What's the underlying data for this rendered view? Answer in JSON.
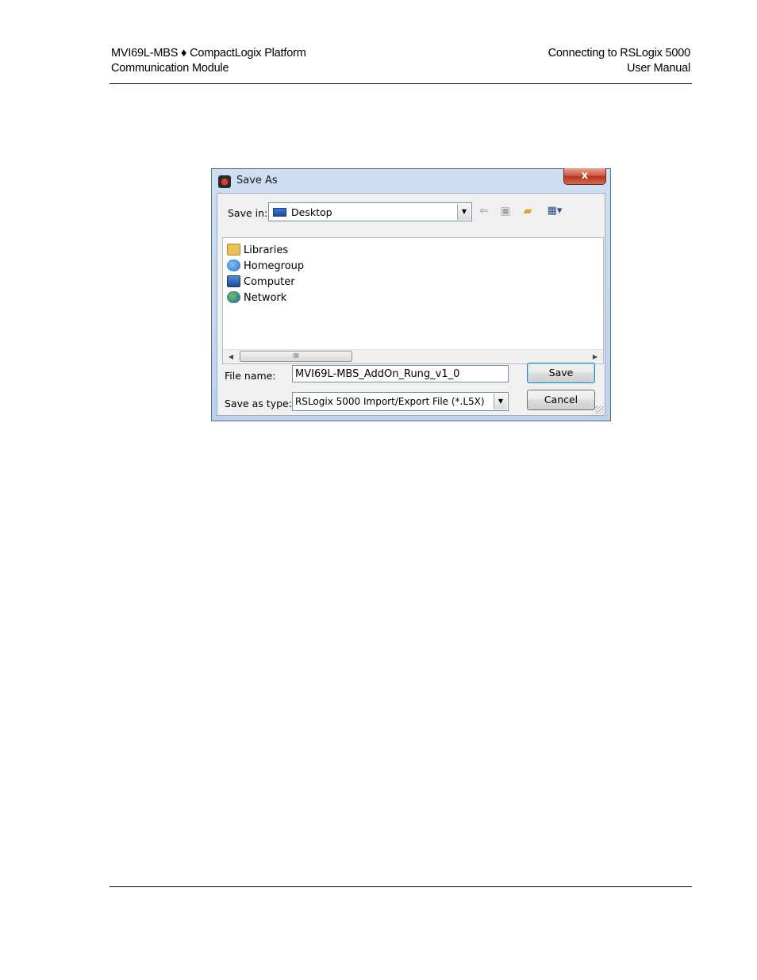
{
  "header": {
    "left_line1": "MVI69L-MBS ♦ CompactLogix Platform",
    "left_line2": "Communication Module",
    "right_line1": "Connecting to RSLogix 5000",
    "right_line2": "User Manual"
  },
  "dialog": {
    "title": "Save As",
    "close_glyph": "x",
    "save_in_label": "Save in:",
    "save_in_value": "Desktop",
    "items": [
      {
        "label": "Libraries",
        "icon": "libraries-icon",
        "color": "#e9c25a"
      },
      {
        "label": "Homegroup",
        "icon": "homegroup-icon",
        "color": "#3f8fd8"
      },
      {
        "label": "Computer",
        "icon": "computer-icon",
        "color": "#2f6fc4"
      },
      {
        "label": "Network",
        "icon": "network-icon",
        "color": "#2e8a3e"
      }
    ],
    "scroll_thumb_glyph": "III",
    "file_name_label": "File name:",
    "file_name_value": "MVI69L-MBS_AddOn_Rung_v1_0",
    "save_type_label": "Save as type:",
    "save_type_value": "RSLogix 5000 Import/Export File (*.L5X)",
    "save_button": "Save",
    "cancel_button": "Cancel"
  }
}
